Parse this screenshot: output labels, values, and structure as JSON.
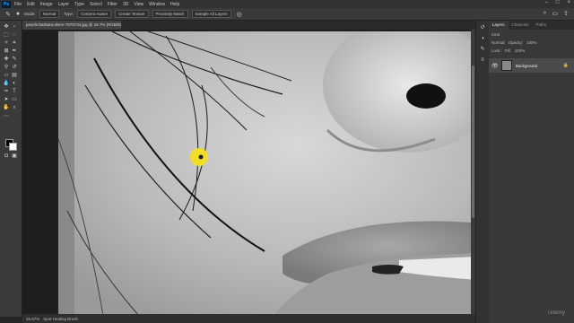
{
  "menubar": {
    "logo": "Ps",
    "items": [
      "File",
      "Edit",
      "Image",
      "Layer",
      "Type",
      "Select",
      "Filter",
      "3D",
      "View",
      "Window",
      "Help"
    ],
    "window_controls": [
      "–",
      "□",
      "×"
    ]
  },
  "options": {
    "mode_label": "Mode:",
    "mode_value": "Normal",
    "type_label": "Type:",
    "buttons": [
      "Content-Aware",
      "Create Texture",
      "Proximity Match"
    ],
    "sample_all": "Sample All Layers"
  },
  "document": {
    "tab_title": "pexels-barbara-olsen-7879734.jpg @ 16.7% (RGB/8) *"
  },
  "status": {
    "zoom": "16.67%",
    "tool_hint": "Spot Healing Brush"
  },
  "panel": {
    "tabs": [
      "Layers",
      "Channels",
      "Paths"
    ],
    "kind_label": "Kind",
    "mode": "Normal",
    "opacity_label": "Opacity:",
    "opacity_value": "100%",
    "lock_label": "Lock:",
    "fill_label": "Fill:",
    "fill_value": "100%",
    "layer_name": "Background"
  },
  "watermark": "Udemy"
}
